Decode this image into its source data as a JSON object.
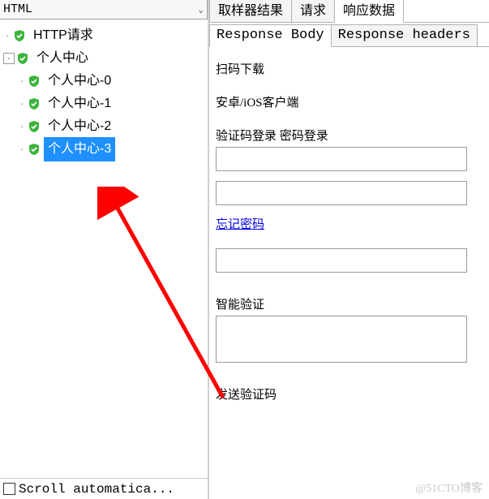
{
  "dropdown": {
    "label": "HTML"
  },
  "tree": {
    "items": [
      {
        "label": "HTTP请求",
        "level": 0,
        "selected": false,
        "expandable": false
      },
      {
        "label": "个人中心",
        "level": 0,
        "selected": false,
        "expandable": true
      },
      {
        "label": "个人中心-0",
        "level": 1,
        "selected": false,
        "expandable": false
      },
      {
        "label": "个人中心-1",
        "level": 1,
        "selected": false,
        "expandable": false
      },
      {
        "label": "个人中心-2",
        "level": 1,
        "selected": false,
        "expandable": false
      },
      {
        "label": "个人中心-3",
        "level": 1,
        "selected": true,
        "expandable": false
      }
    ]
  },
  "scroll_checkbox": {
    "label": "Scroll automatica..."
  },
  "tabs": {
    "items": [
      {
        "label": "取样器结果",
        "active": false
      },
      {
        "label": "请求",
        "active": false
      },
      {
        "label": "响应数据",
        "active": true
      }
    ]
  },
  "subtabs": {
    "items": [
      {
        "label": "Response Body",
        "active": true
      },
      {
        "label": "Response headers",
        "active": false
      }
    ]
  },
  "response_body": {
    "line1": "扫码下载",
    "line2": "安卓/iOS客户端",
    "line3": "验证码登录 密码登录",
    "forgot_password": "忘记密码",
    "smart_verify": "智能验证",
    "send_code": "发送验证码"
  },
  "watermark": "@51CTO博客"
}
